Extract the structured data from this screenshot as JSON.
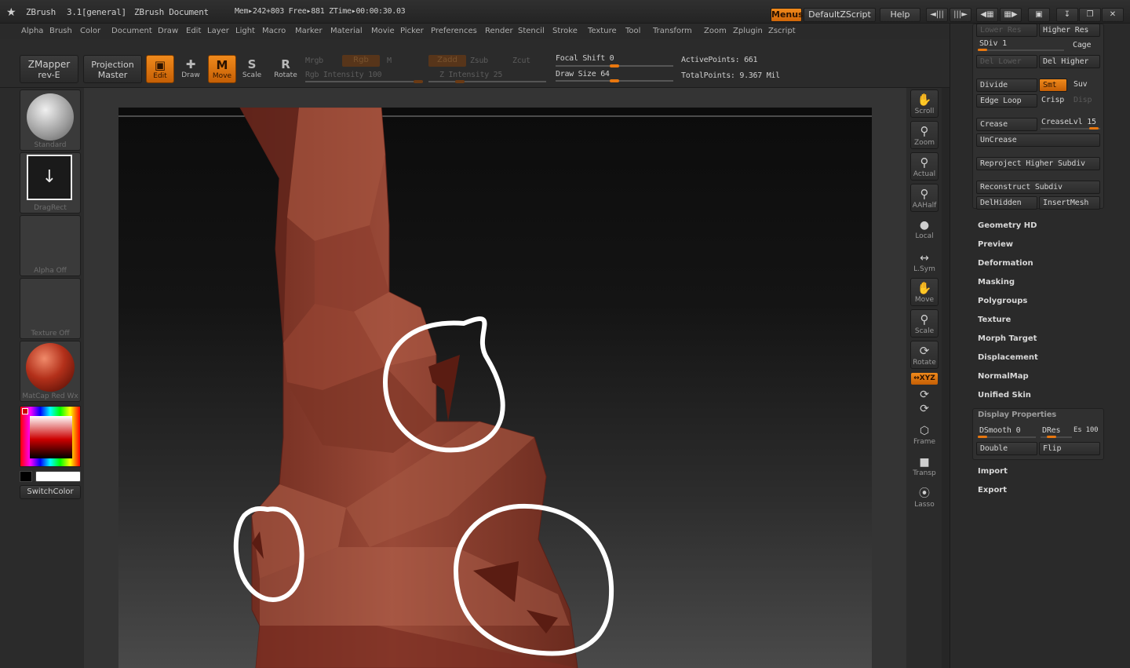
{
  "titlebar": {
    "app": "ZBrush",
    "version": "3.1[general]",
    "document": "ZBrush Document",
    "stats": "Mem▸242+803  Free▸881  ZTime▸00:00:30.03",
    "menus_btn": "Menus",
    "script_btn": "DefaultZScript",
    "help_btn": "Help"
  },
  "menubar": [
    "Alpha",
    "Brush",
    "Color",
    "Document",
    "Draw",
    "Edit",
    "Layer",
    "Light",
    "Macro",
    "Marker",
    "Material",
    "Movie",
    "Picker",
    "Preferences",
    "Render",
    "Stencil",
    "Stroke",
    "Texture",
    "Tool",
    "Transform",
    "Zoom",
    "Zplugin",
    "Zscript"
  ],
  "shelf": {
    "zmapper_line1": "ZMapper",
    "zmapper_line2": "rev-E",
    "projection_line1": "Projection",
    "projection_line2": "Master",
    "edit": "Edit",
    "draw": "Draw",
    "move": "Move",
    "scale": "Scale",
    "rotate": "Rotate",
    "mrgb": "Mrgb",
    "rgb": "Rgb",
    "m": "M",
    "rgb_intensity": "Rgb Intensity 100",
    "zadd": "Zadd",
    "zsub": "Zsub",
    "zcut": "Zcut",
    "z_intensity": "Z Intensity 25",
    "focal_shift": "Focal Shift 0",
    "draw_size": "Draw Size 64",
    "active_points": "ActivePoints: 661",
    "total_points": "TotalPoints: 9.367  Mil"
  },
  "lefttray": {
    "brush": "Standard",
    "stroke": "DragRect",
    "alpha": "Alpha  Off",
    "texture": "Texture  Off",
    "material": "MatCap  Red  Wx",
    "switchcolor": "SwitchColor"
  },
  "righttray": {
    "scroll": "Scroll",
    "zoom": "Zoom",
    "actual": "Actual",
    "aahalf": "AAHalf",
    "local": "Local",
    "lsym": "L.Sym",
    "move": "Move",
    "scale": "Scale",
    "rotate": "Rotate",
    "xyz": "↔XYZ",
    "frame": "Frame",
    "transp": "Transp",
    "lasso": "Lasso"
  },
  "palette": {
    "lower_res": "Lower  Res",
    "higher_res": "Higher  Res",
    "sdiv": "SDiv 1",
    "cage": "Cage",
    "del_lower": "Del  Lower",
    "del_higher": "Del  Higher",
    "divide": "Divide",
    "smt": "Smt",
    "suv": "Suv",
    "edge_loop": "Edge  Loop",
    "crisp": "Crisp",
    "disp": "Disp",
    "crease": "Crease",
    "crease_lvl": "CreaseLvl 15",
    "uncrease": "UnCrease",
    "reproject": "Reproject  Higher  Subdiv",
    "reconstruct": "Reconstruct  Subdiv",
    "delhidden": "DelHidden",
    "insertmesh": "InsertMesh",
    "sections": [
      "Geometry  HD",
      "Preview",
      "Deformation",
      "Masking",
      "Polygroups",
      "Texture",
      "Morph  Target",
      "Displacement",
      "NormalMap",
      "Unified  Skin"
    ],
    "display_properties": "Display  Properties",
    "dsmooth": "DSmooth 0",
    "dres": "DRes",
    "es": "Es 100",
    "double": "Double",
    "flip": "Flip",
    "import": "Import",
    "export": "Export"
  },
  "colors": {
    "accent": "#e8770f",
    "model": "#8a3a2a",
    "background": "#262626"
  }
}
